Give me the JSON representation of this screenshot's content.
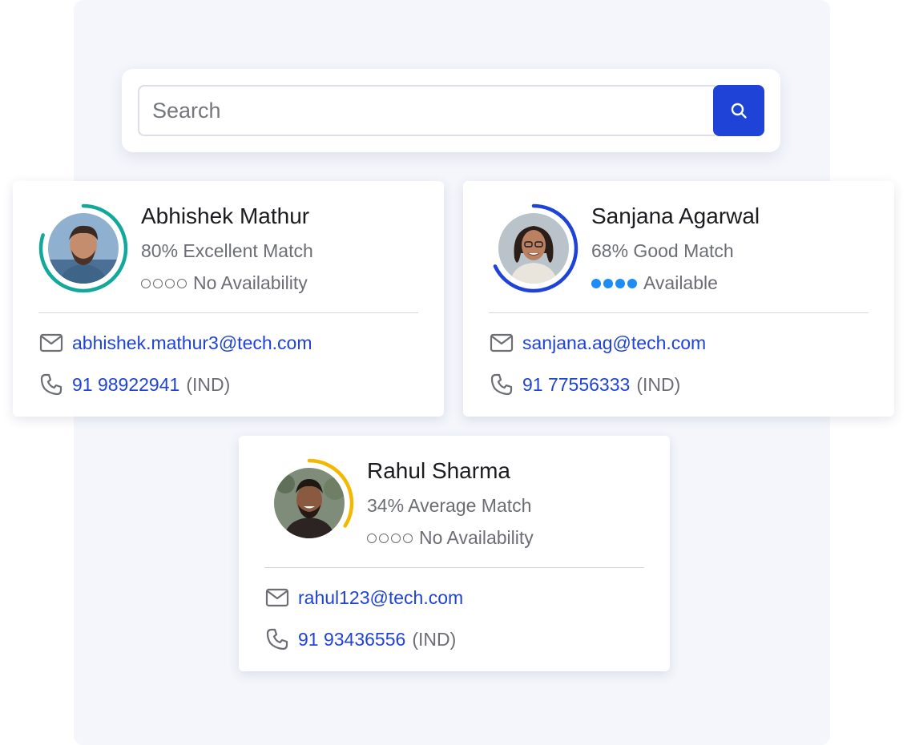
{
  "search": {
    "placeholder": "Search",
    "value": ""
  },
  "candidates": [
    {
      "name": "Abhishek Mathur",
      "match_text": "80% Excellent Match",
      "match_percent": 80,
      "ring_color": "#12a89b",
      "availability_text": "No Availability",
      "availability_dots_filled": 0,
      "email": "abhishek.mathur3@tech.com",
      "phone": "91 98922941",
      "country": "(IND)"
    },
    {
      "name": "Sanjana Agarwal",
      "match_text": "68% Good Match",
      "match_percent": 68,
      "ring_color": "#1f43d6",
      "availability_text": "Available",
      "availability_dots_filled": 4,
      "email": "sanjana.ag@tech.com",
      "phone": "91 77556333",
      "country": "(IND)"
    },
    {
      "name": "Rahul Sharma",
      "match_text": "34% Average Match",
      "match_percent": 34,
      "ring_color": "#f5b800",
      "availability_text": "No Availability",
      "availability_dots_filled": 0,
      "email": "rahul123@tech.com",
      "phone": "91 93436556",
      "country": "(IND)"
    }
  ],
  "colors": {
    "accent": "#1f43d6",
    "available_dot": "#1d8cf5",
    "backdrop": "#f4f6fc"
  },
  "icons": {
    "search": "search-icon",
    "email": "mail-icon",
    "phone": "phone-icon"
  }
}
